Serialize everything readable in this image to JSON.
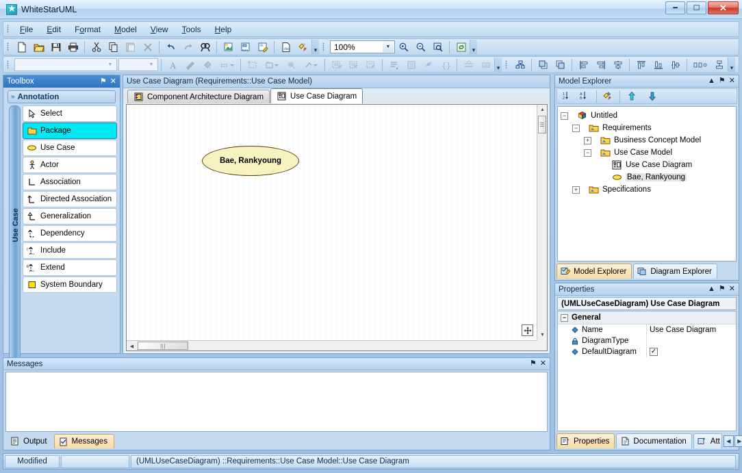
{
  "window": {
    "title": "WhiteStarUML",
    "app_icon": "star-icon",
    "controls": {
      "minimize": "–",
      "maximize": "□",
      "close": "✕"
    }
  },
  "menu": {
    "items": [
      {
        "label": "File",
        "mnemonic": "F"
      },
      {
        "label": "Edit",
        "mnemonic": "E"
      },
      {
        "label": "Format",
        "mnemonic": "o"
      },
      {
        "label": "Model",
        "mnemonic": "M"
      },
      {
        "label": "View",
        "mnemonic": "V"
      },
      {
        "label": "Tools",
        "mnemonic": "T"
      },
      {
        "label": "Help",
        "mnemonic": "H"
      }
    ]
  },
  "toolbar": {
    "zoom_value": "100%",
    "font_combo_value": "",
    "size_combo_value": "",
    "row1_icons": [
      "new-icon",
      "open-icon",
      "save-icon",
      "print-icon",
      "cut-icon",
      "copy-icon",
      "paste-icon",
      "delete-icon",
      "undo-icon",
      "redo-icon",
      "find-icon",
      "new-diagram-icon",
      "add-diagram-icon",
      "edit-diagram-icon",
      "document-icon",
      "validate-icon"
    ],
    "zoom_icons": [
      "zoom-in-icon",
      "zoom-out-icon",
      "zoom-fit-icon",
      "refresh-icon"
    ],
    "row2_icons": [
      "font-color-icon",
      "line-style-icon",
      "fill-color-icon",
      "line-width-icon",
      "shape-icon",
      "stereotype-icon",
      "shadow-icon",
      "direction-icon",
      "suppress1-icon",
      "suppress2-icon",
      "suppress3-icon",
      "align-text-icon",
      "grid-icon",
      "visibility-icon",
      "braces-icon",
      "resize-h-icon",
      "resize-v-icon",
      "layout-icon",
      "bring-front-icon",
      "send-back-icon",
      "align-left-icon",
      "align-right-icon",
      "align-center-icon",
      "align-top-icon",
      "align-bottom-icon",
      "align-middle-icon",
      "space-horizontal-icon",
      "space-vertical-icon"
    ]
  },
  "toolbox": {
    "caption": "Toolbox",
    "pin": "⚑",
    "close": "✕",
    "group_header": "Annotation",
    "vertical_tab": "Use Case",
    "items": [
      {
        "label": "Select",
        "icon": "arrow-cursor-icon",
        "selected": false
      },
      {
        "label": "Package",
        "icon": "package-icon",
        "selected": true
      },
      {
        "label": "Use Case",
        "icon": "use-case-ellipse-icon",
        "selected": false
      },
      {
        "label": "Actor",
        "icon": "actor-stickman-icon",
        "selected": false
      },
      {
        "label": "Association",
        "icon": "association-line-icon",
        "selected": false
      },
      {
        "label": "Directed Association",
        "icon": "directed-association-icon",
        "selected": false
      },
      {
        "label": "Generalization",
        "icon": "generalization-icon",
        "selected": false
      },
      {
        "label": "Dependency",
        "icon": "dependency-icon",
        "selected": false
      },
      {
        "label": "Include",
        "icon": "include-icon",
        "selected": false
      },
      {
        "label": "Extend",
        "icon": "extend-icon",
        "selected": false
      },
      {
        "label": "System Boundary",
        "icon": "system-boundary-icon",
        "selected": false
      }
    ]
  },
  "document": {
    "title": "Use Case Diagram (Requirements::Use Case Model)",
    "tabs": [
      {
        "label": "Component Architecture Diagram",
        "icon": "component-diagram-icon",
        "active": false
      },
      {
        "label": "Use Case Diagram",
        "icon": "use-case-diagram-icon",
        "active": true
      }
    ],
    "canvas": {
      "nodes": [
        {
          "type": "use-case",
          "label": "Bae, Rankyoung",
          "fill": "#f7f2c0",
          "stroke": "#5a3d12"
        }
      ],
      "move_handle_icon": "move-handle-icon"
    }
  },
  "messages": {
    "caption": "Messages",
    "pin": "⚑",
    "close": "✕",
    "content": "",
    "tabs": [
      {
        "label": "Output",
        "icon": "output-icon",
        "active": false
      },
      {
        "label": "Messages",
        "icon": "messages-check-icon",
        "active": true
      }
    ]
  },
  "explorer": {
    "caption": "Model Explorer",
    "collapse": "▲",
    "pin": "⚑",
    "close": "✕",
    "toolbar_icons": [
      "sort-numeric-icon",
      "sort-alpha-icon",
      "filter-icon",
      "move-up-icon",
      "move-down-icon"
    ],
    "tree": [
      {
        "label": "Untitled",
        "icon": "model-cube-icon",
        "depth": 0,
        "expander": "−",
        "selected": false
      },
      {
        "label": "Requirements",
        "icon": "package-folder-icon",
        "depth": 1,
        "expander": "−",
        "selected": false
      },
      {
        "label": "Business Concept Model",
        "icon": "package-folder-icon",
        "depth": 2,
        "expander": "+",
        "selected": false
      },
      {
        "label": "Use Case Model",
        "icon": "package-folder-icon",
        "depth": 2,
        "expander": "−",
        "selected": false
      },
      {
        "label": "Use Case Diagram",
        "icon": "use-case-diagram-icon",
        "depth": 3,
        "expander": "",
        "selected": false
      },
      {
        "label": "Bae, Rankyoung",
        "icon": "use-case-ellipse-icon",
        "depth": 3,
        "expander": "",
        "selected": true
      },
      {
        "label": "Specifications",
        "icon": "package-folder-icon",
        "depth": 1,
        "expander": "+",
        "selected": false
      }
    ],
    "tabs": [
      {
        "label": "Model Explorer",
        "icon": "model-explorer-icon",
        "active": true
      },
      {
        "label": "Diagram Explorer",
        "icon": "diagram-explorer-icon",
        "active": false
      }
    ]
  },
  "properties": {
    "caption": "Properties",
    "collapse": "▲",
    "pin": "⚑",
    "close": "✕",
    "header": "(UMLUseCaseDiagram) Use Case Diagram",
    "group": "General",
    "group_expander": "−",
    "rows": [
      {
        "name": "Name",
        "value": "Use Case Diagram",
        "icon": "property-diamond-icon",
        "type": "text"
      },
      {
        "name": "DiagramType",
        "value": "",
        "icon": "property-lock-icon",
        "type": "text"
      },
      {
        "name": "DefaultDiagram",
        "value": "✓",
        "icon": "property-diamond-icon",
        "type": "checkbox"
      }
    ],
    "tabs": [
      {
        "label": "Properties",
        "icon": "properties-icon",
        "active": true
      },
      {
        "label": "Documentation",
        "icon": "documentation-icon",
        "active": false
      },
      {
        "label": "Att",
        "icon": "attach-icon",
        "active": false
      }
    ],
    "scroll_left": "◀",
    "scroll_right": "▶"
  },
  "statusbar": {
    "modified": "Modified",
    "blank": "",
    "path": "(UMLUseCaseDiagram) ::Requirements::Use Case Model::Use Case Diagram"
  },
  "colors": {
    "accent": "#2f74bd",
    "selection": "#00e8f0",
    "usecase_fill": "#f7f2c0",
    "folder_yellow": "#ffd24d",
    "tab_active": "#f7dba6"
  }
}
